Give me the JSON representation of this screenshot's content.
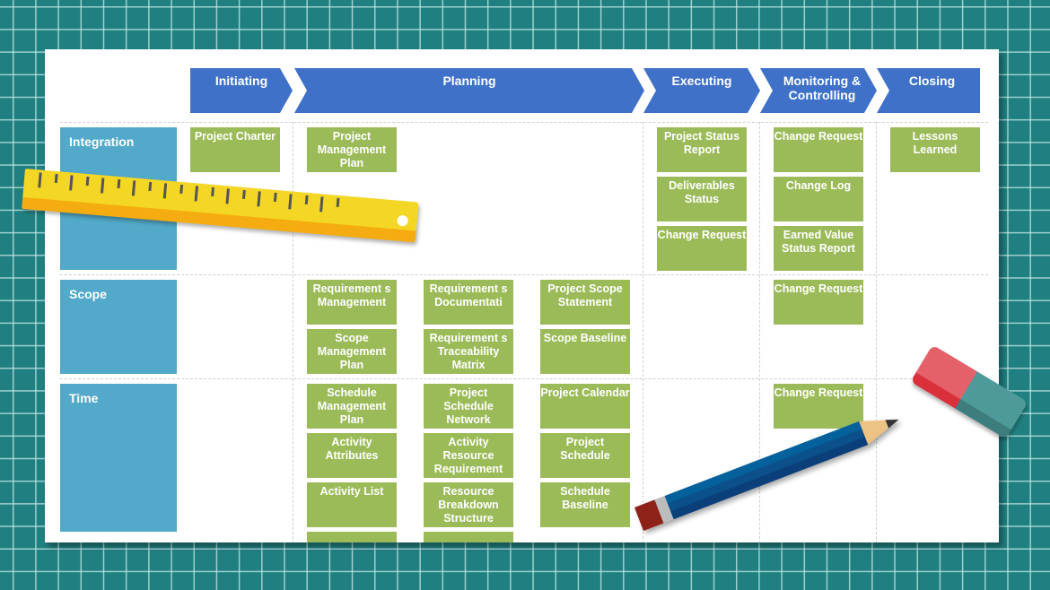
{
  "diagram": {
    "phases": [
      {
        "label": "Initiating"
      },
      {
        "label": "Planning"
      },
      {
        "label": "Executing"
      },
      {
        "label": "Monitoring & Controlling"
      },
      {
        "label": "Closing"
      }
    ],
    "knowledge_areas": [
      {
        "label": "Integration"
      },
      {
        "label": "Scope"
      },
      {
        "label": "Time"
      }
    ],
    "rows": {
      "integration": {
        "initiating": [
          "Project Charter"
        ],
        "planning": [
          "Project Management Plan"
        ],
        "executing": [
          "Project Status Report",
          "Deliverables Status",
          "Change Request"
        ],
        "monitoring": [
          "Change Request",
          "Change Log",
          "Earned Value Status Report"
        ],
        "closing": [
          "Lessons Learned"
        ]
      },
      "scope": {
        "planning": [
          "Requirement s Management",
          "Requirement s Documentati",
          "Project Scope Statement",
          "Scope Management Plan",
          "Requirement s Traceability Matrix",
          "Scope Baseline"
        ],
        "monitoring": [
          "Change Request"
        ]
      },
      "time": {
        "planning": [
          "Schedule Management Plan",
          "Project Schedule Network",
          "Project Calendar",
          "Activity Attributes",
          "Activity Resource Requirement",
          "Project Schedule",
          "Activity List",
          "Resource Breakdown Structure",
          "Schedule Baseline"
        ],
        "monitoring": [
          "Change Request"
        ]
      }
    },
    "colors": {
      "background": "#207F80",
      "phase": "#4071C9",
      "knowledge_area": "#52A9C9",
      "deliverable": "#9BBB59"
    },
    "decorations": [
      "ruler",
      "eraser",
      "pencil"
    ]
  }
}
